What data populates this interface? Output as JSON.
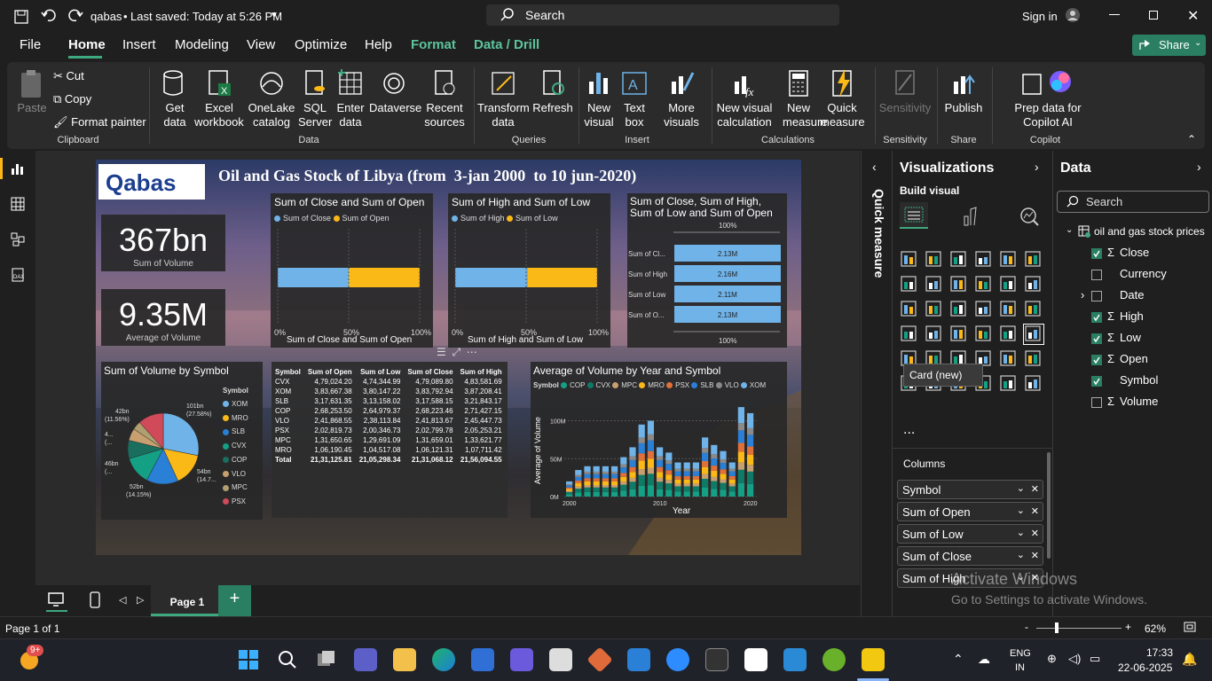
{
  "titlebar": {
    "filename": "qabas",
    "saved": "Last saved: Today at 5:26 PM",
    "search": "Search",
    "signin": "Sign in"
  },
  "menu": {
    "items": [
      "File",
      "Home",
      "Insert",
      "Modeling",
      "View",
      "Optimize",
      "Help",
      "Format",
      "Data / Drill"
    ],
    "active": "Home",
    "share": "Share"
  },
  "ribbon": {
    "clipboard": {
      "paste": "Paste",
      "cut": "Cut",
      "copy": "Copy",
      "format_painter": "Format painter",
      "group": "Clipboard"
    },
    "data": {
      "get_data": "Get data",
      "excel": "Excel workbook",
      "onelake": "OneLake catalog",
      "sql": "SQL Server",
      "enter": "Enter data",
      "dataverse": "Dataverse",
      "recent": "Recent sources",
      "group": "Data"
    },
    "queries": {
      "transform": "Transform data",
      "refresh": "Refresh",
      "group": "Queries"
    },
    "insert": {
      "new_visual": "New visual",
      "text_box": "Text box",
      "more_visuals": "More visuals",
      "group": "Insert"
    },
    "calc": {
      "new_visual_calc": "New visual calculation",
      "new_measure": "New measure",
      "quick_measure": "Quick measure",
      "group": "Calculations"
    },
    "sensitivity": {
      "label": "Sensitivity",
      "group": "Sensitivity"
    },
    "share": {
      "publish": "Publish",
      "group": "Share"
    },
    "copilot": {
      "prep": "Prep data for Copilot AI",
      "group": "Copilot"
    }
  },
  "report": {
    "logo": "Qabas",
    "title": "Oil and Gas Stock of Libya (from  3-jan 2000  to 10 jun-2020)",
    "card1": {
      "value": "367bn",
      "label": "Sum of Volume"
    },
    "card2": {
      "value": "9.35M",
      "label": "Average of Volume"
    },
    "chart1": {
      "title": "Sum of Close and Sum of Open",
      "legend": [
        "Sum of Close",
        "Sum of Open"
      ],
      "ticks": [
        "0%",
        "50%",
        "100%"
      ],
      "axis": "Sum of Close and Sum of Open"
    },
    "chart2": {
      "title": "Sum of High and Sum of Low",
      "legend": [
        "Sum of High",
        "Sum of Low"
      ],
      "ticks": [
        "0%",
        "50%",
        "100%"
      ],
      "axis": "Sum of High and Sum of Low"
    },
    "chart3": {
      "title": "Sum of Close, Sum of High, Sum of Low and Sum of Open",
      "top": "100%",
      "bottom": "100%",
      "rows": [
        {
          "label": "Sum of Cl...",
          "value": "2.13M"
        },
        {
          "label": "Sum of High",
          "value": "2.16M"
        },
        {
          "label": "Sum of Low",
          "value": "2.11M"
        },
        {
          "label": "Sum of O...",
          "value": "2.13M"
        }
      ]
    },
    "pie": {
      "title": "Sum of Volume by Symbol",
      "legend_title": "Symbol",
      "legend": [
        "XOM",
        "MRO",
        "SLB",
        "CVX",
        "COP",
        "VLO",
        "MPC",
        "PSX"
      ],
      "labels": [
        "101bn",
        "(27.58%)",
        "54bn",
        "(14.7...",
        "52bn",
        "(14.15%)",
        "46bn",
        "(...",
        "4...",
        "(...",
        "42bn",
        "(11.56%)"
      ]
    },
    "table": {
      "headers": [
        "Symbol",
        "Sum of Open",
        "Sum of Low",
        "Sum of Close",
        "Sum of High"
      ],
      "rows": [
        [
          "CVX",
          "4,79,024.20",
          "4,74,344.99",
          "4,79,089.80",
          "4,83,581.69"
        ],
        [
          "XOM",
          "3,83,667.38",
          "3,80,147.22",
          "3,83,792.94",
          "3,87,208.41"
        ],
        [
          "SLB",
          "3,17,631.35",
          "3,13,158.02",
          "3,17,588.15",
          "3,21,843.17"
        ],
        [
          "COP",
          "2,68,253.50",
          "2,64,979.37",
          "2,68,223.46",
          "2,71,427.15"
        ],
        [
          "VLO",
          "2,41,868.55",
          "2,38,113.84",
          "2,41,813.67",
          "2,45,447.73"
        ],
        [
          "PSX",
          "2,02,819.73",
          "2,00,346.73",
          "2,02,799.78",
          "2,05,253.21"
        ],
        [
          "MPC",
          "1,31,650.65",
          "1,29,691.09",
          "1,31,659.01",
          "1,33,621.77"
        ],
        [
          "MRO",
          "1,06,190.45",
          "1,04,517.08",
          "1,06,121.31",
          "1,07,711.42"
        ]
      ],
      "total": [
        "Total",
        "21,31,125.81",
        "21,05,298.34",
        "21,31,068.12",
        "21,56,094.55"
      ]
    },
    "stack": {
      "title": "Average of Volume by Year and Symbol",
      "legend_title": "Symbol",
      "legend": [
        "COP",
        "CVX",
        "MPC",
        "MRO",
        "PSX",
        "SLB",
        "VLO",
        "XOM"
      ],
      "yticks": [
        "100M",
        "50M",
        "0M"
      ],
      "xticks": [
        "2000",
        "2010",
        "2020"
      ],
      "xlabel": "Year",
      "ylabel": "Average of Volume"
    }
  },
  "chart_data": [
    {
      "type": "bar",
      "title": "Sum of Close and Sum of Open",
      "series": [
        {
          "name": "Sum of Close",
          "values": [
            0.5
          ]
        },
        {
          "name": "Sum of Open",
          "values": [
            0.5
          ]
        }
      ]
    },
    {
      "type": "bar",
      "title": "Sum of High and Sum of Low",
      "series": [
        {
          "name": "Sum of High",
          "values": [
            0.51
          ]
        },
        {
          "name": "Sum of Low",
          "values": [
            0.49
          ]
        }
      ]
    },
    {
      "type": "bar",
      "title": "Sum of Close, Sum of High, Sum of Low and Sum of Open",
      "categories": [
        "Sum of Cl...",
        "Sum of High",
        "Sum of Low",
        "Sum of O..."
      ],
      "values": [
        2.13,
        2.16,
        2.11,
        2.13
      ]
    },
    {
      "type": "pie",
      "title": "Sum of Volume by Symbol",
      "categories": [
        "XOM",
        "MRO",
        "SLB",
        "CVX",
        "COP",
        "VLO",
        "MPC",
        "PSX"
      ],
      "values": [
        101,
        54,
        52,
        46,
        30,
        20,
        14,
        42
      ]
    },
    {
      "type": "bar",
      "title": "Average of Volume by Year and Symbol",
      "x": [
        2000,
        2001,
        2002,
        2003,
        2004,
        2005,
        2006,
        2007,
        2008,
        2009,
        2010,
        2011,
        2012,
        2013,
        2014,
        2015,
        2016,
        2017,
        2018,
        2019,
        2020
      ],
      "totals": [
        20,
        35,
        40,
        40,
        40,
        40,
        52,
        65,
        95,
        100,
        65,
        58,
        45,
        45,
        45,
        78,
        68,
        60,
        45,
        118,
        110
      ]
    }
  ],
  "colors": {
    "accent": "#3ea87f",
    "blue": "#6fb3e8",
    "yellow": "#fbb917",
    "teal": "#14a085"
  },
  "viz": {
    "header": "Visualizations",
    "build": "Build visual",
    "tooltip": "Card (new)",
    "columns_label": "Columns",
    "wells": [
      "Symbol",
      "Sum of Open",
      "Sum of Low",
      "Sum of Close",
      "Sum of High"
    ],
    "more": "..."
  },
  "data": {
    "header": "Data",
    "search": "Search",
    "table": "oil and gas stock prices",
    "fields": [
      {
        "name": "Close",
        "sigma": true,
        "checked": true
      },
      {
        "name": "Currency",
        "sigma": false,
        "checked": false
      },
      {
        "name": "Date",
        "sigma": false,
        "checked": false,
        "expand": true
      },
      {
        "name": "High",
        "sigma": true,
        "checked": true
      },
      {
        "name": "Low",
        "sigma": true,
        "checked": true
      },
      {
        "name": "Open",
        "sigma": true,
        "checked": true
      },
      {
        "name": "Symbol",
        "sigma": false,
        "checked": true
      },
      {
        "name": "Volume",
        "sigma": true,
        "checked": false
      }
    ]
  },
  "quick_measure": "Quick measure",
  "tabs": {
    "page": "Page 1"
  },
  "status": {
    "page": "Page 1 of 1",
    "zoom": "62%"
  },
  "watermark": {
    "line1": "Activate Windows",
    "line2": "Go to Settings to activate Windows."
  },
  "taskbar": {
    "badge": "9+",
    "lang1": "ENG",
    "lang2": "IN",
    "time": "17:33",
    "date": "22-06-2025"
  }
}
